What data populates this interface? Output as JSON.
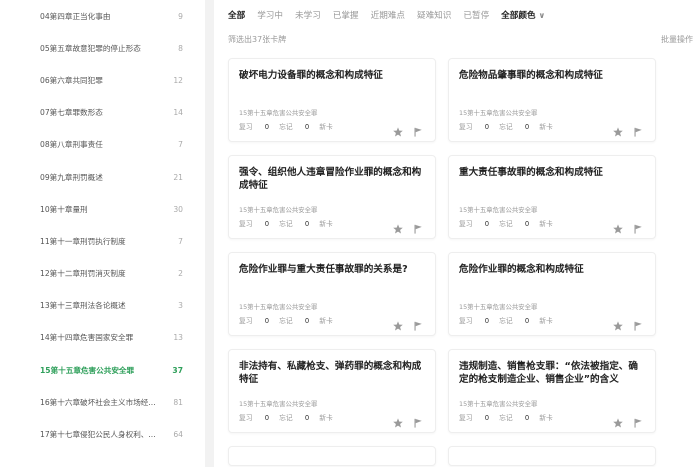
{
  "sidebar": {
    "items": [
      {
        "label": "04第四章正当化事由",
        "count": "9"
      },
      {
        "label": "05第五章故意犯罪的停止形态",
        "count": "8"
      },
      {
        "label": "06第六章共同犯罪",
        "count": "12"
      },
      {
        "label": "07第七章罪数形态",
        "count": "14"
      },
      {
        "label": "08第八章刑事责任",
        "count": "7"
      },
      {
        "label": "09第九章刑罚概述",
        "count": "21"
      },
      {
        "label": "10第十章量刑",
        "count": "30"
      },
      {
        "label": "11第十一章刑罚执行制度",
        "count": "7"
      },
      {
        "label": "12第十二章刑罚消灭制度",
        "count": "2"
      },
      {
        "label": "13第十三章刑法各论概述",
        "count": "3"
      },
      {
        "label": "14第十四章危害国家安全罪",
        "count": "13"
      },
      {
        "label": "15第十五章危害公共安全罪",
        "count": "37"
      },
      {
        "label": "16第十六章破坏社会主义市场经...",
        "count": "81"
      },
      {
        "label": "17第十七章侵犯公民人身权利、...",
        "count": "64"
      }
    ]
  },
  "filters": {
    "tabs": [
      "全部",
      "学习中",
      "未学习",
      "已掌握",
      "近期难点",
      "疑难知识",
      "已暂停"
    ],
    "color_label": "全部颜色",
    "color_chevron": "∨"
  },
  "summary": {
    "count_text": "筛选出37张卡牌",
    "batch_label": "批量操作"
  },
  "cards": [
    {
      "title": "破坏电力设备罪的概念和构成特征",
      "chapter": "15第十五章危害公共安全罪",
      "review_label": "复习",
      "review": "0",
      "forget_label": "忘记",
      "forget": "0",
      "status": "新卡"
    },
    {
      "title": "危险物品肇事罪的概念和构成特征",
      "chapter": "15第十五章危害公共安全罪",
      "review_label": "复习",
      "review": "0",
      "forget_label": "忘记",
      "forget": "0",
      "status": "新卡"
    },
    {
      "title": "强令、组织他人违章冒险作业罪的概念和构成特征",
      "chapter": "15第十五章危害公共安全罪",
      "review_label": "复习",
      "review": "0",
      "forget_label": "忘记",
      "forget": "0",
      "status": "新卡"
    },
    {
      "title": "重大责任事故罪的概念和构成特征",
      "chapter": "15第十五章危害公共安全罪",
      "review_label": "复习",
      "review": "0",
      "forget_label": "忘记",
      "forget": "0",
      "status": "新卡"
    },
    {
      "title": "危险作业罪与重大责任事故罪的关系是?",
      "chapter": "15第十五章危害公共安全罪",
      "review_label": "复习",
      "review": "0",
      "forget_label": "忘记",
      "forget": "0",
      "status": "新卡"
    },
    {
      "title": "危险作业罪的概念和构成特征",
      "chapter": "15第十五章危害公共安全罪",
      "review_label": "复习",
      "review": "0",
      "forget_label": "忘记",
      "forget": "0",
      "status": "新卡"
    },
    {
      "title": "非法持有、私藏枪支、弹药罪的概念和构成特征",
      "chapter": "15第十五章危害公共安全罪",
      "review_label": "复习",
      "review": "0",
      "forget_label": "忘记",
      "forget": "0",
      "status": "新卡"
    },
    {
      "title": "违规制造、销售枪支罪：“依法被指定、确定的枪支制造企业、销售企业”的含义",
      "chapter": "15第十五章危害公共安全罪",
      "review_label": "复习",
      "review": "0",
      "forget_label": "忘记",
      "forget": "0",
      "status": "新卡"
    }
  ],
  "colors": {
    "active_green": "#2e9f5a",
    "icon_gray": "#9a9a9a"
  },
  "icons": {
    "star": "star-icon",
    "flag": "flag-icon"
  }
}
